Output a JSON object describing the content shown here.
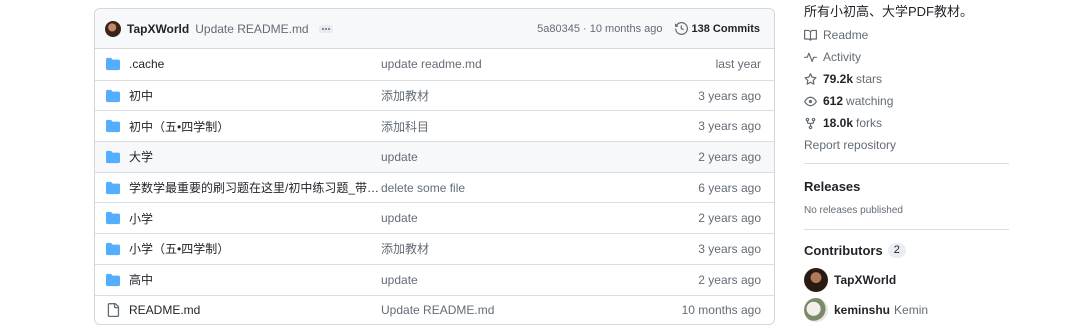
{
  "commit": {
    "author": "TapXWorld",
    "message": "Update README.md",
    "sha_time": "5a80345 · 10 months ago",
    "commits_count": "138 Commits"
  },
  "files": [
    {
      "type": "folder",
      "name": ".cache",
      "message": "update readme.md",
      "age": "last year"
    },
    {
      "type": "folder",
      "name": "初中",
      "message": "添加教材",
      "age": "3 years ago"
    },
    {
      "type": "folder",
      "name": "初中（五•四学制）",
      "message": "添加科目",
      "age": "3 years ago"
    },
    {
      "type": "folder",
      "name": "大学",
      "message": "update",
      "age": "2 years ago",
      "highlight": true
    },
    {
      "type": "folder",
      "name": "学数学最重要的刷习题在这里/初中练习题_带答...",
      "message": "delete some file",
      "age": "6 years ago"
    },
    {
      "type": "folder",
      "name": "小学",
      "message": "update",
      "age": "2 years ago"
    },
    {
      "type": "folder",
      "name": "小学（五•四学制）",
      "message": "添加教材",
      "age": "3 years ago"
    },
    {
      "type": "folder",
      "name": "高中",
      "message": "update",
      "age": "2 years ago"
    },
    {
      "type": "file",
      "name": "README.md",
      "message": "Update README.md",
      "age": "10 months ago"
    }
  ],
  "sidebar": {
    "about": "所有小初高、大学PDF教材。",
    "readme": "Readme",
    "activity": "Activity",
    "stars_num": "79.2k",
    "stars_label": "stars",
    "watching_num": "612",
    "watching_label": "watching",
    "forks_num": "18.0k",
    "forks_label": "forks",
    "report": "Report repository",
    "releases_title": "Releases",
    "releases_empty": "No releases published",
    "contributors_title": "Contributors",
    "contributors_count": "2",
    "contributors": [
      {
        "login": "TapXWorld",
        "name": ""
      },
      {
        "login": "keminshu",
        "name": "Kemin"
      }
    ]
  },
  "colors": {
    "folder": "#54aeff",
    "muted": "#636c76",
    "border": "#d0d7de"
  }
}
